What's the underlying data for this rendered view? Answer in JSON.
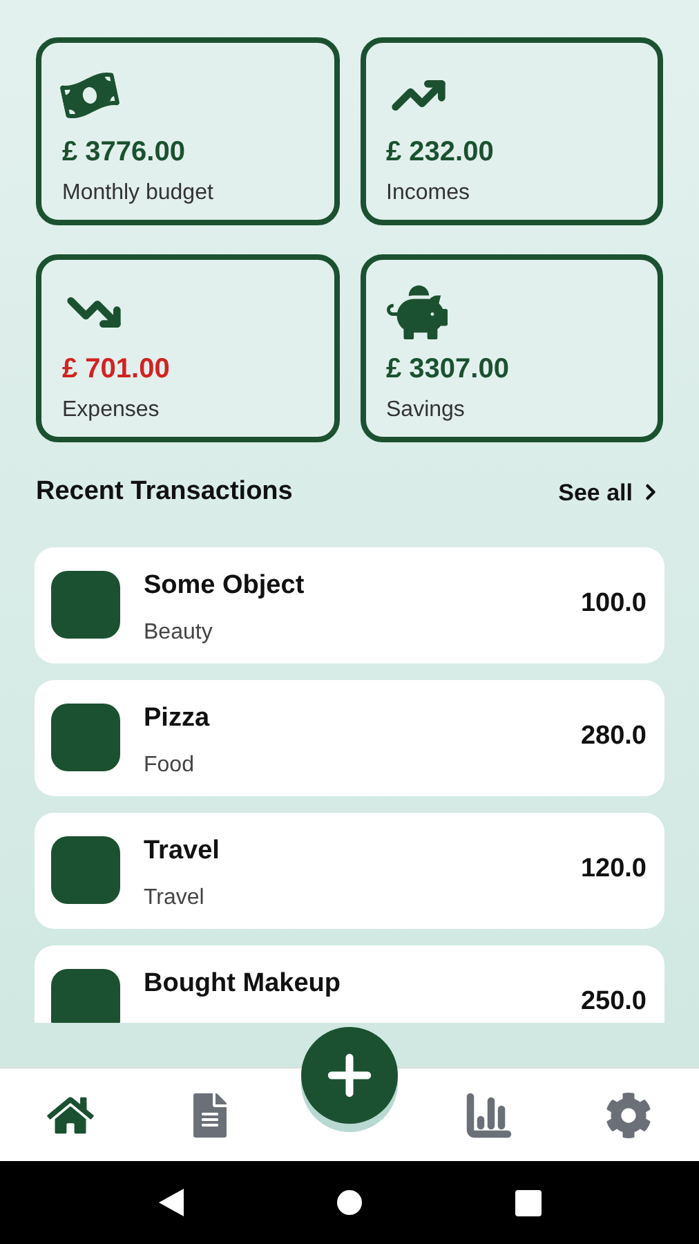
{
  "summary_cards": [
    {
      "kind": "budget",
      "amount": "£ 3776.00",
      "label": "Monthly budget",
      "negative": false
    },
    {
      "kind": "income",
      "amount": "£ 232.00",
      "label": "Incomes",
      "negative": false
    },
    {
      "kind": "expense",
      "amount": "£ 701.00",
      "label": "Expenses",
      "negative": true
    },
    {
      "kind": "savings",
      "amount": "£ 3307.00",
      "label": "Savings",
      "negative": false
    }
  ],
  "recent": {
    "title": "Recent Transactions",
    "see_all": "See all"
  },
  "transactions": [
    {
      "name": "Some Object",
      "category": "Beauty",
      "amount": "100.0"
    },
    {
      "name": "Pizza",
      "category": "Food",
      "amount": "280.0"
    },
    {
      "name": "Travel",
      "category": "Travel",
      "amount": "120.0"
    },
    {
      "name": "Bought Makeup",
      "amount": "250.0"
    }
  ],
  "bottom_nav": [
    {
      "kind": "home",
      "selected": true
    },
    {
      "kind": "document",
      "selected": false
    },
    {
      "kind": "add"
    },
    {
      "kind": "stats",
      "selected": false
    },
    {
      "kind": "settings",
      "selected": false
    }
  ]
}
